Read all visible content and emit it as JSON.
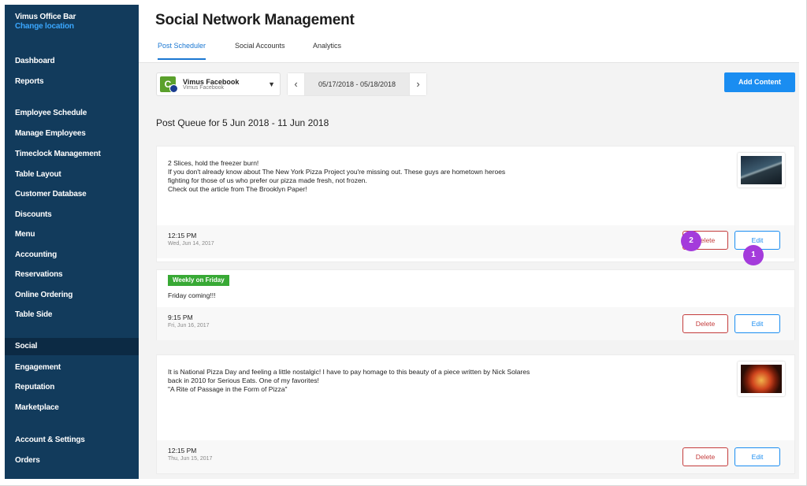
{
  "sidebar": {
    "location_name": "Vimus Office Bar",
    "change_location": "Change location",
    "items": [
      {
        "label": "Dashboard"
      },
      {
        "label": "Reports"
      },
      {
        "label": "Employee Schedule"
      },
      {
        "label": "Manage Employees"
      },
      {
        "label": "Timeclock Management"
      },
      {
        "label": "Table Layout"
      },
      {
        "label": "Customer Database"
      },
      {
        "label": "Discounts"
      },
      {
        "label": "Menu"
      },
      {
        "label": "Accounting"
      },
      {
        "label": "Reservations"
      },
      {
        "label": "Online Ordering"
      },
      {
        "label": "Table Side"
      },
      {
        "label": "Social",
        "active": true
      },
      {
        "label": "Engagement"
      },
      {
        "label": "Reputation"
      },
      {
        "label": "Marketplace"
      },
      {
        "label": "Account & Settings"
      },
      {
        "label": "Orders"
      }
    ]
  },
  "header": {
    "title": "Social Network Management",
    "tabs": [
      {
        "label": "Post Scheduler",
        "active": true
      },
      {
        "label": "Social Accounts"
      },
      {
        "label": "Analytics"
      }
    ]
  },
  "toolbar": {
    "account_icon_letter": "C",
    "account_name": "Vimus Facebook",
    "account_sub": "Vimus Facebook",
    "date_range": "05/17/2018 - 05/18/2018",
    "add_content": "Add Content"
  },
  "queue": {
    "title": "Post Queue for 5 Jun 2018 - 11 Jun 2018",
    "posts": [
      {
        "lines": [
          "2 Slices, hold the freezer burn!",
          "If you don't already know about The New York Pizza Project you're missing out. These guys are hometown heroes",
          "fighting for those of us who prefer our pizza made fresh, not frozen.",
          "Check out the article from The Brooklyn Paper!"
        ],
        "time": "12:15 PM",
        "date": "Wed, Jun 14, 2017",
        "delete": "Delete",
        "edit": "Edit",
        "thumb": "pizza-city-image"
      },
      {
        "tag": "Weekly on Friday",
        "lines": [
          "Friday coming!!!"
        ],
        "time": "9:15 PM",
        "date": "Fri, Jun 16, 2017",
        "delete": "Delete",
        "edit": "Edit"
      },
      {
        "lines": [
          "It is National Pizza Day and feeling a little nostalgic! I have to pay homage to this beauty of a piece written by Nick Solares",
          "back in 2010 for Serious Eats. One of my favorites!",
          "\"A Rite of Passage in the Form of Pizza\""
        ],
        "time": "12:15 PM",
        "date": "Thu, Jun 15, 2017",
        "delete": "Delete",
        "edit": "Edit",
        "thumb": "pizza-image"
      }
    ]
  },
  "markers": {
    "first": "1",
    "second": "2"
  },
  "colors": {
    "sidebar_bg": "#123b5c",
    "accent_blue": "#1a8df1",
    "delete_red": "#c43c3c",
    "tag_green": "#38a935",
    "marker_purple": "#a43bdb"
  }
}
